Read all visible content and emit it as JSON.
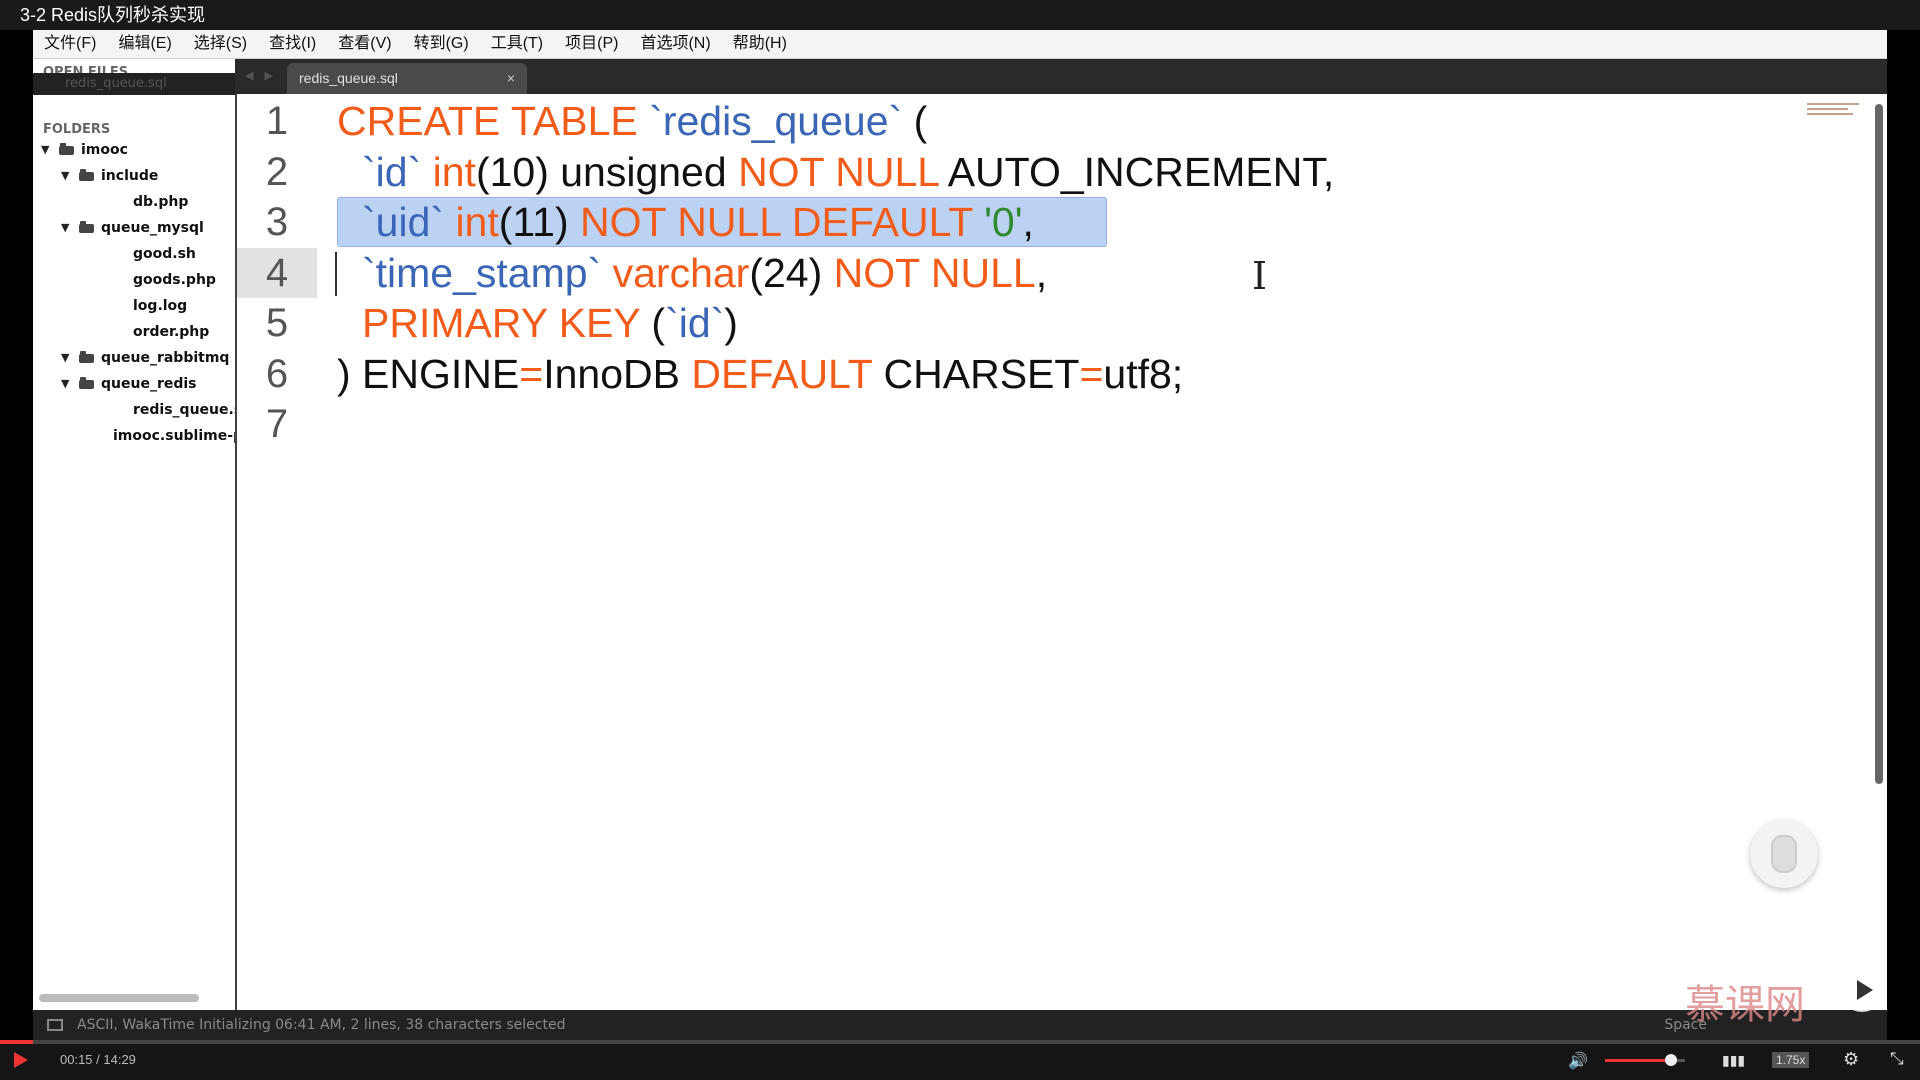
{
  "video": {
    "title": "3-2 Redis队列秒杀实现",
    "time": "00:15 / 14:29",
    "progress": 0.017,
    "volume": 0.82,
    "speed": "1.75x"
  },
  "menu": [
    "文件(F)",
    "编辑(E)",
    "选择(S)",
    "查找(I)",
    "查看(V)",
    "转到(G)",
    "工具(T)",
    "项目(P)",
    "首选项(N)",
    "帮助(H)"
  ],
  "sidebar": {
    "open_files_header": "OPEN FILES",
    "open_file": "redis_queue.sql",
    "folders_header": "FOLDERS",
    "tree": [
      {
        "label": "imooc",
        "level": 0,
        "type": "folder",
        "expanded": true
      },
      {
        "label": "include",
        "level": 1,
        "type": "folder",
        "expanded": true
      },
      {
        "label": "db.php",
        "level": 2,
        "type": "file"
      },
      {
        "label": "queue_mysql",
        "level": 1,
        "type": "folder",
        "expanded": true
      },
      {
        "label": "good.sh",
        "level": 2,
        "type": "file"
      },
      {
        "label": "goods.php",
        "level": 2,
        "type": "file"
      },
      {
        "label": "log.log",
        "level": 2,
        "type": "file"
      },
      {
        "label": "order.php",
        "level": 2,
        "type": "file"
      },
      {
        "label": "queue_rabbitmq",
        "level": 1,
        "type": "folder",
        "expanded": true
      },
      {
        "label": "queue_redis",
        "level": 1,
        "type": "folder",
        "expanded": true
      },
      {
        "label": "redis_queue.sql",
        "level": 2,
        "type": "file"
      },
      {
        "label": "imooc.sublime-project",
        "level": 1,
        "type": "file"
      }
    ]
  },
  "tab": {
    "label": "redis_queue.sql",
    "close": "×"
  },
  "editor": {
    "active_line": 4,
    "selected_line": 3,
    "line_numbers": [
      "1",
      "2",
      "3",
      "4",
      "5",
      "6",
      "7"
    ],
    "lines": [
      [
        {
          "t": "CREATE TABLE",
          "c": "kw"
        },
        {
          "t": " ",
          "c": ""
        },
        {
          "t": "`redis_queue`",
          "c": "str"
        },
        {
          "t": " (",
          "c": ""
        }
      ],
      [
        {
          "t": "`id`",
          "c": "str"
        },
        {
          "t": " ",
          "c": ""
        },
        {
          "t": "int",
          "c": "kw"
        },
        {
          "t": "(10) unsigned ",
          "c": ""
        },
        {
          "t": "NOT NULL",
          "c": "kw"
        },
        {
          "t": " AUTO_INCREMENT,",
          "c": ""
        }
      ],
      [
        {
          "t": "`uid`",
          "c": "str"
        },
        {
          "t": " ",
          "c": ""
        },
        {
          "t": "int",
          "c": "kw"
        },
        {
          "t": "(11) ",
          "c": ""
        },
        {
          "t": "NOT NULL DEFAULT",
          "c": "kw"
        },
        {
          "t": " ",
          "c": ""
        },
        {
          "t": "'0'",
          "c": "lit"
        },
        {
          "t": ",",
          "c": ""
        }
      ],
      [
        {
          "t": "`time_stamp`",
          "c": "str"
        },
        {
          "t": " ",
          "c": ""
        },
        {
          "t": "varchar",
          "c": "kw"
        },
        {
          "t": "(24) ",
          "c": ""
        },
        {
          "t": "NOT NULL",
          "c": "kw"
        },
        {
          "t": ",",
          "c": ""
        }
      ],
      [
        {
          "t": "PRIMARY KEY",
          "c": "kw"
        },
        {
          "t": " (",
          "c": ""
        },
        {
          "t": "`id`",
          "c": "str"
        },
        {
          "t": ")",
          "c": ""
        }
      ],
      [
        {
          "t": ") ENGINE",
          "c": ""
        },
        {
          "t": "=",
          "c": "kw"
        },
        {
          "t": "InnoDB ",
          "c": ""
        },
        {
          "t": "DEFAULT",
          "c": "kw"
        },
        {
          "t": " CHARSET",
          "c": ""
        },
        {
          "t": "=",
          "c": "kw"
        },
        {
          "t": "utf8;",
          "c": ""
        }
      ],
      []
    ],
    "indented": [
      false,
      true,
      true,
      true,
      true,
      false,
      false
    ]
  },
  "status": {
    "text": "ASCII, WakaTime Initializing 06:41 AM, 2 lines, 38 characters selected",
    "right": "Space",
    "watermark": "慕课网"
  },
  "colors": {
    "keyword": "#f25c1a",
    "identifier": "#3a66b5",
    "string_literal": "#2f8a2f",
    "selection": "#bcd2f3",
    "progress": "#e33333"
  }
}
